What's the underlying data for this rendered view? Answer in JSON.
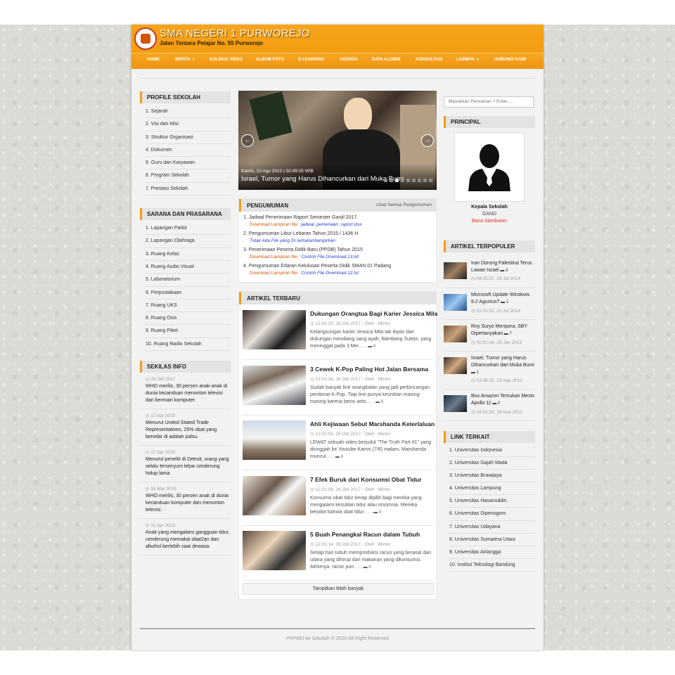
{
  "site": {
    "title": "SMA NEGERI 1 PURWOREJO",
    "address": "Jalan Tentara Pelajar No. 55 Purworejo"
  },
  "nav": [
    {
      "label": "HOME",
      "caret": false
    },
    {
      "label": "BERITA",
      "caret": true
    },
    {
      "label": "KOLEKSI VIDEO",
      "caret": false
    },
    {
      "label": "ALBUM FOTO",
      "caret": false
    },
    {
      "label": "E-LEARNING",
      "caret": false
    },
    {
      "label": "AGENDA",
      "caret": false
    },
    {
      "label": "DATA ALUMNI",
      "caret": false
    },
    {
      "label": "KONSULTASI",
      "caret": false
    },
    {
      "label": "LAINNYA",
      "caret": true
    },
    {
      "label": "HUBUNGI KAMI",
      "caret": false
    }
  ],
  "profile": {
    "title": "PROFILE SEKOLAH",
    "items": [
      "1. Sejarah",
      "2. Visi dan Misi",
      "3. Struktur Organisasi",
      "4. Dokumen",
      "5. Guru dan Karyawan",
      "6. Program Sekolah",
      "7. Prestasi Sekolah"
    ]
  },
  "sarana": {
    "title": "SARANA DAN PRASARANA",
    "items": [
      "1. Lapangan Parkir",
      "2. Lapangan Olahraga",
      "3. Ruang Kelas",
      "4. Ruang Audio Visual",
      "5. Laboratorium",
      "6. Perpustakaan",
      "7. Ruang UKS",
      "8. Ruang Osis",
      "9. Ruang Piket",
      "10. Ruang Radio Sekolah"
    ]
  },
  "sekilas": {
    "title": "SEKILAS INFO",
    "items": [
      {
        "date": "26 Okt 2017",
        "text": "WHO merilis, 30 persen anak-anak di dunia kecanduan menonton televisi dan bermain komputer."
      },
      {
        "date": "17 Apr 2015",
        "text": "Menurut United Stated Trade Representatives, 25% obat yang beredar di adalah palsu."
      },
      {
        "date": "17 Apr 2015",
        "text": "Menurut peneliti di Detroit, orang yang selalu tersenyum lebar cenderung hidup lama."
      },
      {
        "date": "16 Mar 2015",
        "text": "WHO merilis, 30 persen anak di dunia kecanduan komputer dan menonton televisi."
      },
      {
        "date": "11 Apr 2015",
        "text": "Anak yang mengalami gangguan tidur, cenderung memakai obat2an dan alkohol berlebih saat dewasa."
      }
    ]
  },
  "slider": {
    "date": "Kamis, 23 Agu 2012 | 02:49:25 WIB",
    "title": "Israel, Tumor yang Harus Dihancurkan dari Muka Bumi",
    "prev": "←",
    "next": "→"
  },
  "pengumuman": {
    "title": "PENGUMUMAN",
    "more": "Lihat Semua Pengumuman",
    "items": [
      {
        "title": "1. Jadwal Penerimaan Raport Semester Ganjil 2017",
        "prefix": "Download Lampiran file : ",
        "file": "jadwal_pemeriaan_raport.xlsx",
        "none": false
      },
      {
        "title": "2. Pengumuman Libur Lebaran Tahun 2015 / 1436 H",
        "prefix": "",
        "file": "Tidak Ada File yang Di sertakan/lampirkan",
        "none": true
      },
      {
        "title": "3. Penerimaan Peserta Didik Baru (PPDB) Tahun 2015",
        "prefix": "Download Lampiran file : ",
        "file": "Contoh File Download 13.txt",
        "none": false
      },
      {
        "title": "4. Pengumuman Edaran Kelulusan Peserta Didik SMAN 01 Padang",
        "prefix": "Download Lampiran file : ",
        "file": "Contoh File Download 12.txt",
        "none": false
      }
    ]
  },
  "latest": {
    "title": "ARTIKEL TERBARU",
    "show_more": "Tampilkan lebih banyak",
    "items": [
      {
        "title": "Dukungan Orangtua Bagi Karier Jessica Mila",
        "meta": "12:01:20, 26 Okt 2017 - Oleh : Mimin",
        "excerpt": "Kelangsungan karier Jessica Mila tak lepas dari dukungan mendiang sang ayah, Bambang Sutejo, yang meninggal pada 3 Mei . . .",
        "comments": "0"
      },
      {
        "title": "3 Cewek K-Pop Paling Hot Jalan Bersama",
        "meta": "12:01:26, 26 Okt 2017 - Oleh : Mimin",
        "excerpt": "Sudah banyak line seangkatan yang jadi perbincangan penikmat K-Pop. Tiap line punya keunikan masing-masing karena berisi artis . . .",
        "comments": "0"
      },
      {
        "title": "Ahli Kejiwaan Sebut Marshanda Keterlaluan",
        "meta": "12:01:03, 26 Okt 2017 - Oleh : Mimin",
        "excerpt": "LEWAT sebuah video berjudul \"The Truth Part #1\" yang diunggah ke Youtube Kamis (7/8) malam, Marshanda muncul . . .",
        "comments": "0"
      },
      {
        "title": "7 Efek Buruk dari Konsumsi Obat Tidur",
        "meta": "12:01:08, 26 Okt 2017 - Oleh : Mimin",
        "excerpt": "Konsumsi obat tidur kerap dipilih bagi mereka yang mengalami kesulitan tidur atau insomnia. Mereka berpikir bahwa obat tidur . . .",
        "comments": "0"
      },
      {
        "title": "5 Buah Penangkal Racun dalam Tubuh",
        "meta": "12:01:14, 26 Okt 2017 - Oleh : Mimin",
        "excerpt": "Setiap hari tubuh memproduksi racun yang berasal dari udara yang dihirup dan makanan yang dikonsumsi. Akhirnya, racun pun . . .",
        "comments": "0"
      }
    ]
  },
  "search": {
    "placeholder": "Masukkan Pencarian + Enter....."
  },
  "principal": {
    "title": "PRINCIPAL",
    "role": "Kepala Sekolah",
    "name": "GAND",
    "link": "Baca Sambutan"
  },
  "popular": {
    "title": "ARTIKEL TERPOPULER",
    "items": [
      {
        "title": "Iran Dorong Palestina Terus Lawan Israel",
        "count": "3",
        "date": "09:15:57, 24 Jul 2014"
      },
      {
        "title": "Microsoft Update Windows 8.2 Agustus?",
        "count": "1",
        "date": "21:22:52, 21 Jul 2014"
      },
      {
        "title": "Roy Suryo Menpora, SBY Dipertanyakan",
        "count": "7",
        "date": "00:01:04, 25 Jan 2013"
      },
      {
        "title": "Israel, Tumor yang Harus Dihancurkan dari Muka Bumi",
        "count": "1",
        "date": "02:49:25, 23 Agu 2012"
      },
      {
        "title": "Bos Amazon Temukan Mesin Apollo 11",
        "count": "0",
        "date": "04:51:31, 19 Nov 2012"
      }
    ]
  },
  "links": {
    "title": "LINK TERKAIT",
    "items": [
      "1. Universitas Indonesia",
      "2. Universitas Gajah Mada",
      "3. Universitas Brawijaya",
      "4. Universitas Lampung",
      "5. Universitas Hasanuddin",
      "6. Universitas Dipenogoro",
      "7. Universitas Udayana",
      "8. Universitas Sumatera Utara",
      "9. Universitas Airlangga",
      "10. Institut Teknologi Bandung"
    ]
  },
  "footer": {
    "text": "PHPMU ke Sekolah © 2020 All Right Reserved"
  },
  "colors": {
    "accent": "#f39c12",
    "link_red": "#dd3322",
    "file_blue": "#223ecc"
  }
}
